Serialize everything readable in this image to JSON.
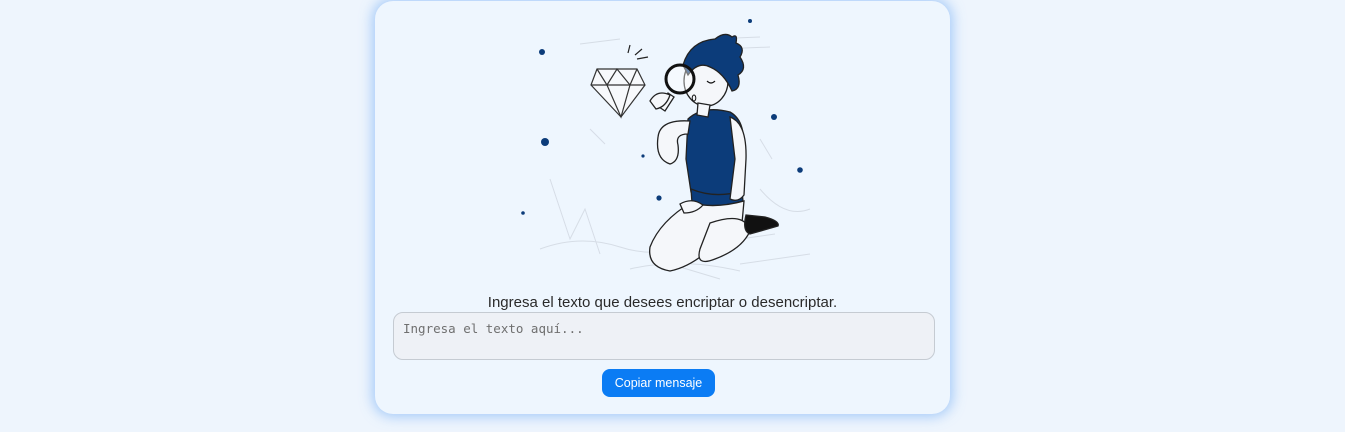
{
  "main": {
    "prompt": "Ingresa el texto que desees encriptar o desencriptar.",
    "input_placeholder": "Ingresa el texto aquí...",
    "copy_button_label": "Copiar mensaje"
  },
  "illustration": {
    "icon": "person-with-magnifying-glass-diamond-illustration",
    "accent_color": "#0c3c7a"
  },
  "colors": {
    "page_background": "#eef5fd",
    "card_background": "#eef6fe",
    "button_background": "#0b7cf4",
    "button_text": "#ffffff"
  }
}
